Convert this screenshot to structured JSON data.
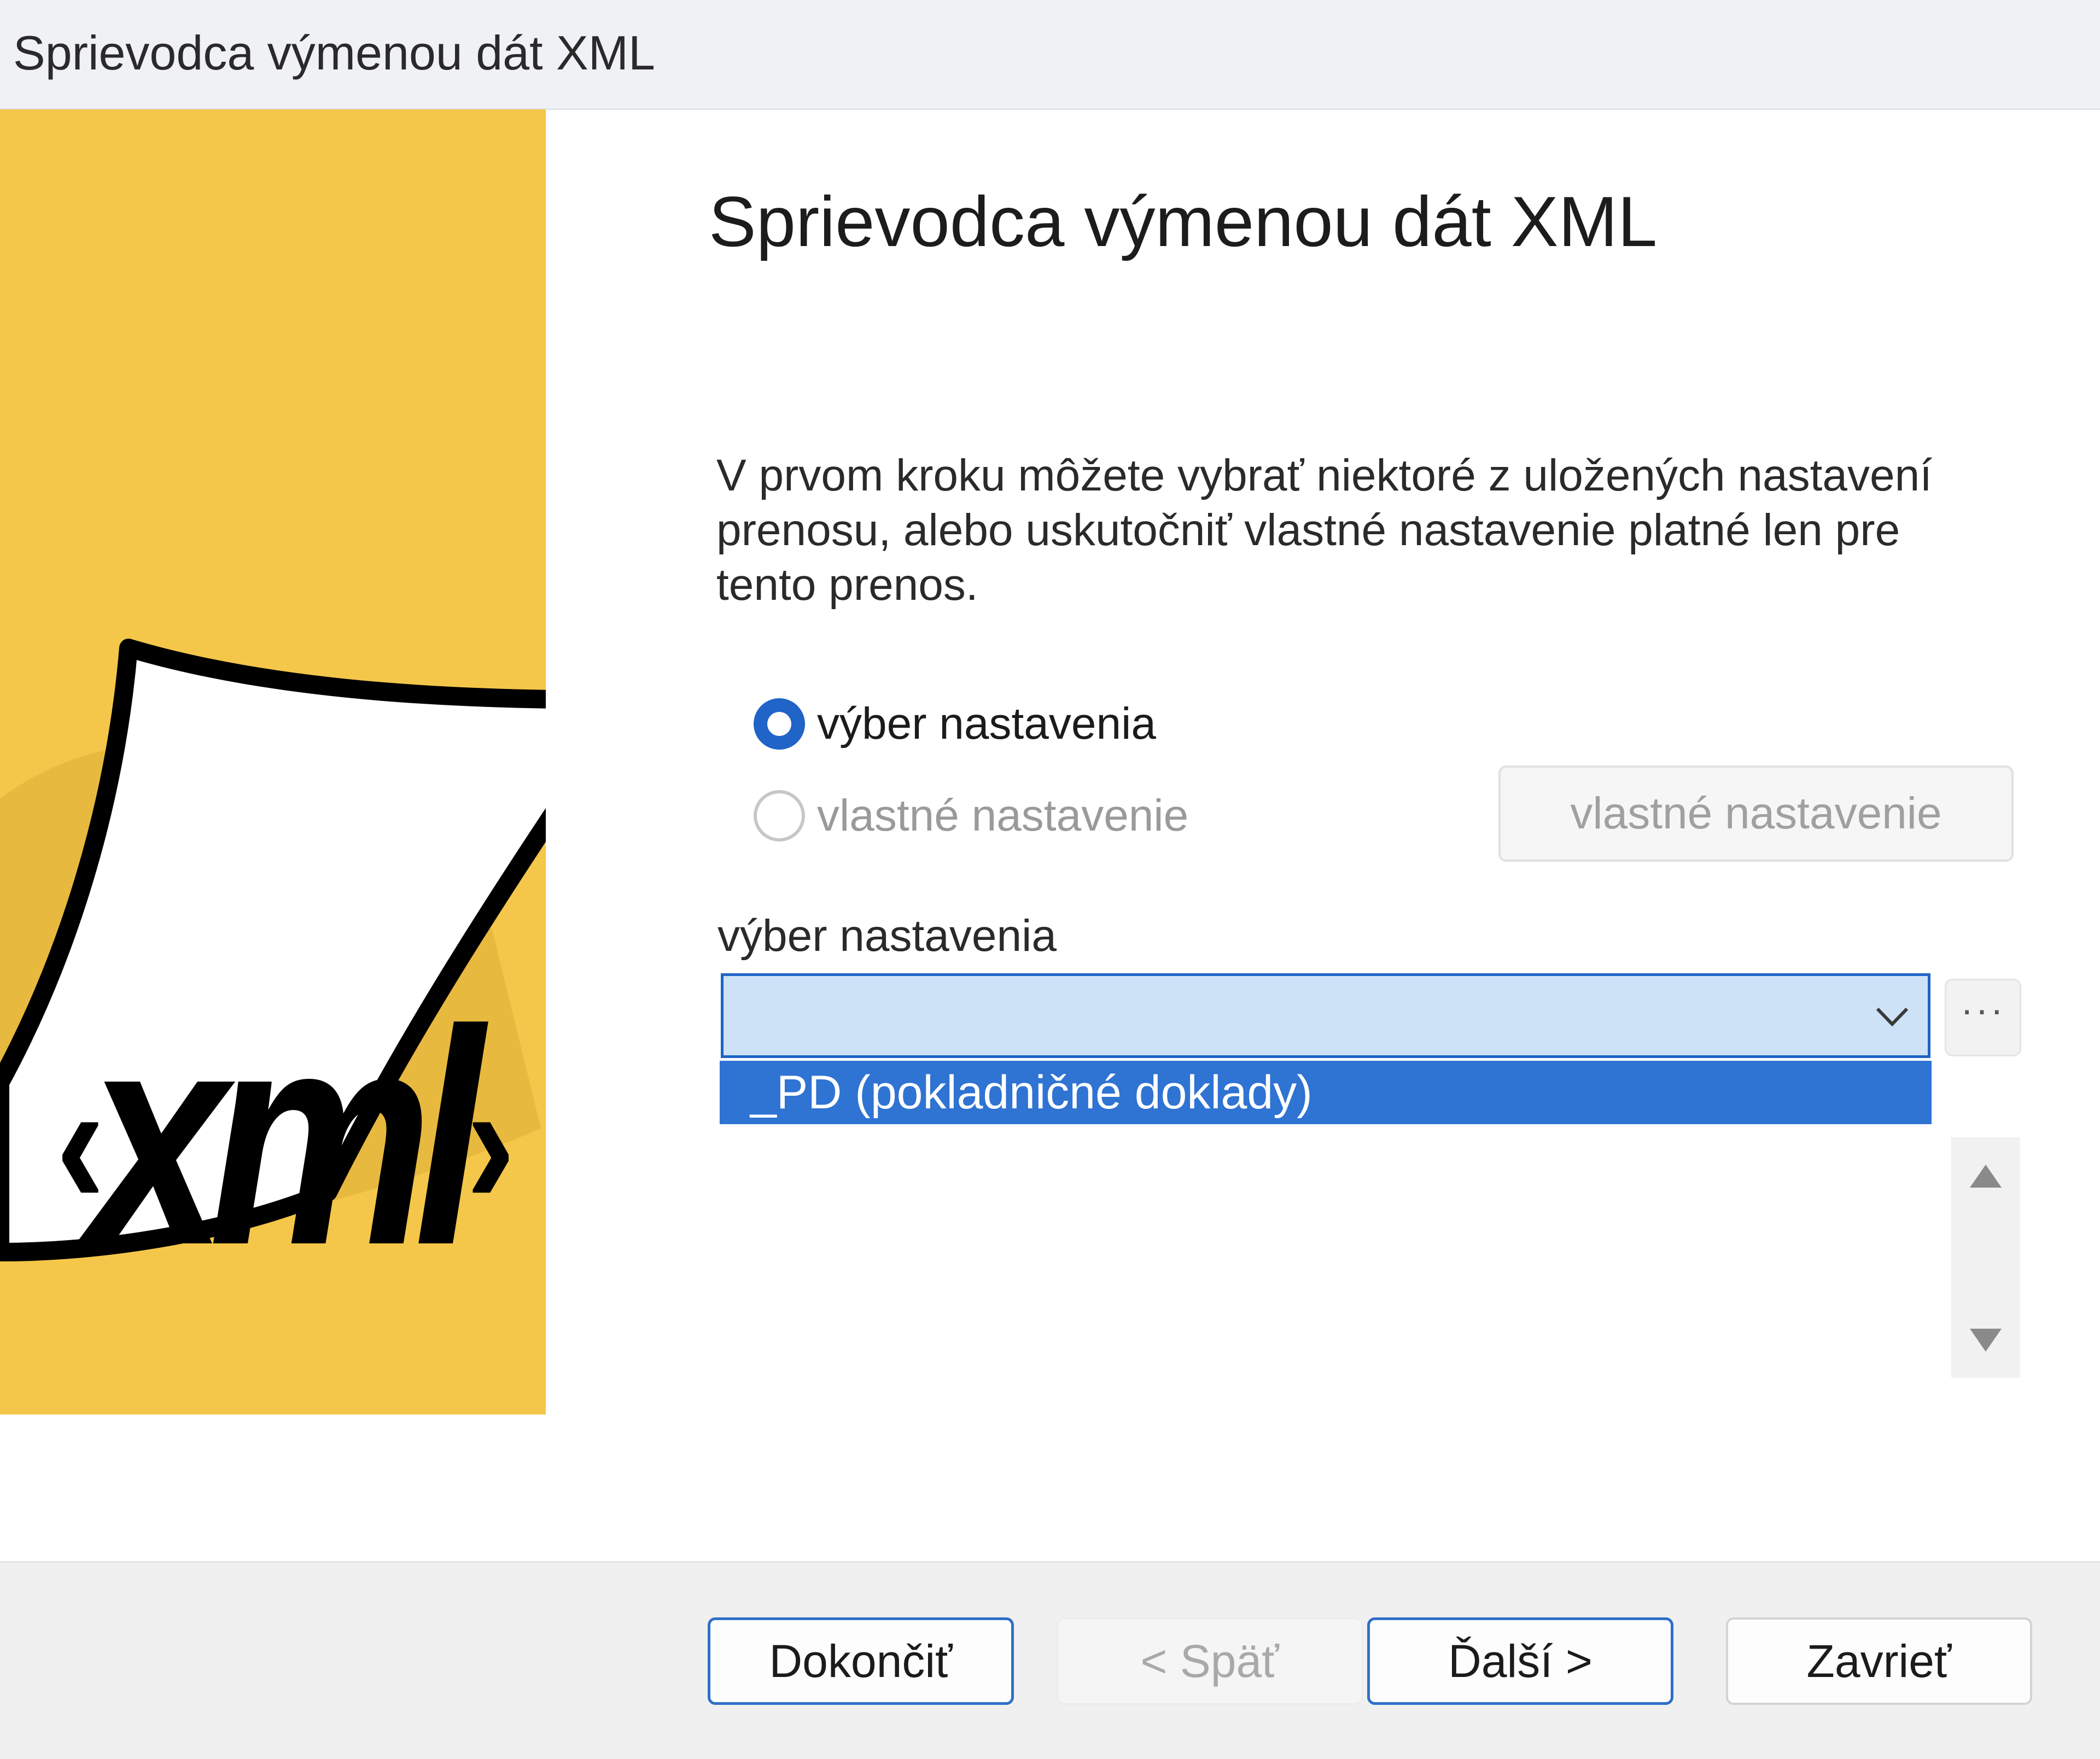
{
  "window": {
    "title": "Sprievodca výmenou dát XML"
  },
  "side_panel": {
    "logo_text": "xml",
    "logo_left": "‹",
    "logo_right": "›",
    "accent_color": "#f4c74a"
  },
  "main": {
    "heading": "Sprievodca výmenou dát XML",
    "intro": "V prvom kroku môžete vybrať niektoré z uložených nastavení prenosu, alebo uskutočniť vlastné nastavenie platné len pre tento prenos.",
    "options": [
      {
        "label": "výber nastavenia",
        "checked": true,
        "enabled": true
      },
      {
        "label": "vlastné nastavenie",
        "checked": false,
        "enabled": false
      }
    ],
    "custom_button": "vlastné nastavenie",
    "combo": {
      "label": "výber nastavenia",
      "value": "",
      "ellipsis": "···",
      "items": [
        {
          "label": "_PD (pokladničné doklady)",
          "selected": true
        }
      ]
    }
  },
  "footer": {
    "finish": "Dokončiť",
    "back": "< Späť",
    "next": "Ďalší >",
    "close": "Zavrieť"
  },
  "colors": {
    "accent_blue": "#1f64c6",
    "selection": "#2f73d3",
    "combo_bg": "#cde2f6"
  }
}
